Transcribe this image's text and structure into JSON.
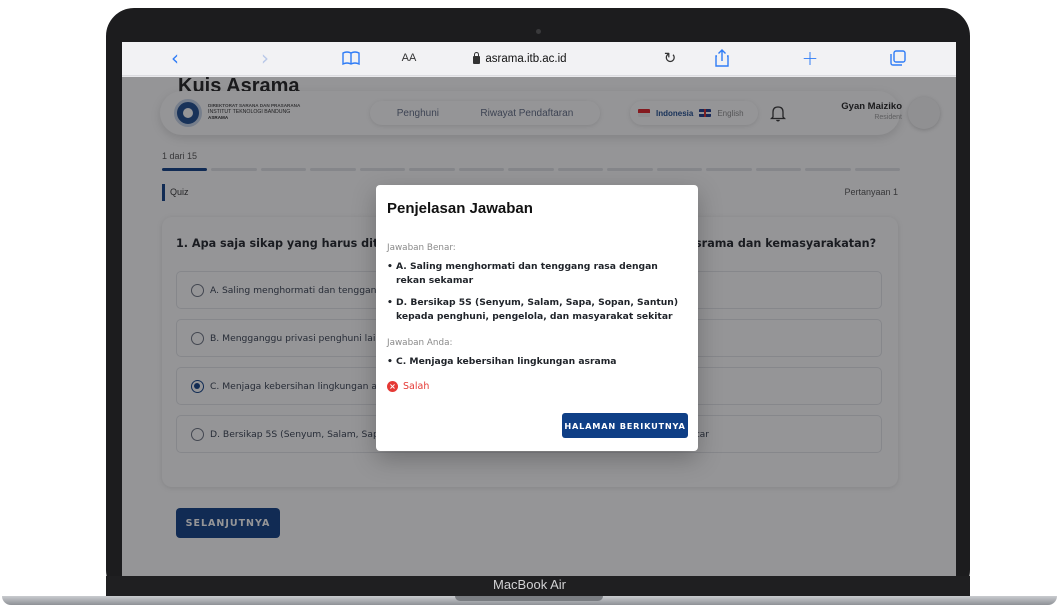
{
  "device": {
    "model_label": "MacBook Air"
  },
  "browser": {
    "text_size_label": "AA",
    "url": "asrama.itb.ac.id"
  },
  "page": {
    "heading": "Kuis Asrama"
  },
  "navbar": {
    "brand": {
      "line1": "DIREKTORAT SARANA DAN PRASARANA",
      "line2": "INSTITUT TEKNOLOGI BANDUNG",
      "line3": "ASRAMA"
    },
    "links": [
      "Penghuni",
      "Riwayat Pendaftaran"
    ],
    "languages": {
      "active": "Indonesia",
      "other": "English"
    },
    "user": {
      "name": "Gyan Maiziko",
      "role": "Resident"
    }
  },
  "quiz": {
    "progress_label": "1 dari 15",
    "total_steps": 15,
    "current_step": 1,
    "section_label": "Quiz",
    "question_counter": "Pertanyaan 1",
    "question": "1. Apa saja sikap yang harus ditunjukkan penghuni asrama dalam kehidupan berasrama dan kemasyarakatan?",
    "options": [
      {
        "text": "A. Saling menghormati dan tenggang rasa dengan rekan sekamar",
        "selected": false
      },
      {
        "text": "B. Mengganggu privasi penghuni lain",
        "selected": false
      },
      {
        "text": "C. Menjaga kebersihan lingkungan asrama",
        "selected": true
      },
      {
        "text": "D. Bersikap 5S (Senyum, Salam, Sapa, Sopan, Santun) kepada penghuni, pengelola, dan masyarakat sekitar",
        "selected": false
      }
    ],
    "next_label": "SELANJUTNYA"
  },
  "modal": {
    "title": "Penjelasan Jawaban",
    "correct_heading": "Jawaban Benar:",
    "correct_answers": [
      "A. Saling menghormati dan tenggang rasa dengan rekan sekamar",
      "D. Bersikap 5S (Senyum, Salam, Sapa, Sopan, Santun) kepada penghuni, pengelola, dan masyarakat sekitar"
    ],
    "your_heading": "Jawaban Anda:",
    "your_answers": [
      "C. Menjaga kebersihan lingkungan asrama"
    ],
    "status": "Salah",
    "next_page_label": "HALAMAN BERIKUTNYA"
  },
  "colors": {
    "primary": "#0f3f86",
    "error": "#e53935",
    "link": "#2f7cf6"
  }
}
